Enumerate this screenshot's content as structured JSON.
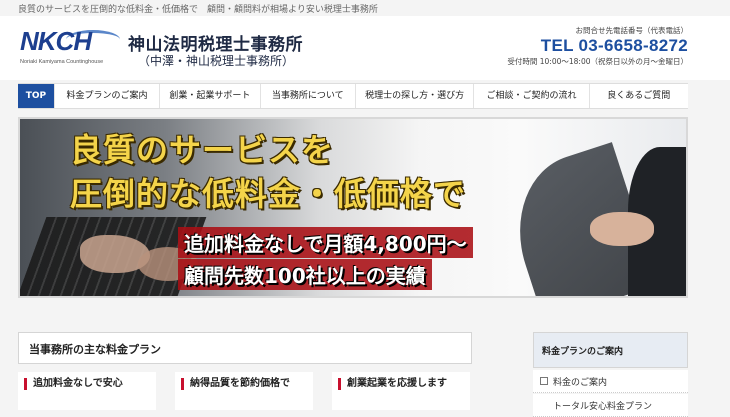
{
  "topbar": {
    "tagline": "良質のサービスを圧倒的な低料金・低価格で　顧問・顧問料が相場より安い税理士事務所"
  },
  "header": {
    "logo_text": "NKCH",
    "logo_sub": "Noriaki Kamiyama Countinghouse",
    "firm_name": "神山法明税理士事務所",
    "firm_sub": "（中澤・神山税理士事務所）",
    "contact_label": "お問合せ先電話番号（代表電話）",
    "tel": "TEL 03-6658-8272",
    "hours": "受付時間 10:00～18:00（祝祭日以外の月～金曜日）"
  },
  "nav": {
    "items": [
      {
        "label": "TOP",
        "active": true
      },
      {
        "label": "料金プランのご案内"
      },
      {
        "label": "創業・起業サポート"
      },
      {
        "label": "当事務所について"
      },
      {
        "label": "税理士の探し方・選び方"
      },
      {
        "label": "ご相談・ご契約の流れ"
      },
      {
        "label": "良くあるご質問"
      }
    ]
  },
  "hero": {
    "headline_1": "良質のサービスを",
    "headline_2": "圧倒的な低料金・低価格で",
    "sub_1": "追加料金なしで月額4,800円～",
    "sub_2": "顧問先数100社以上の実績"
  },
  "main": {
    "section_title": "当事務所の主な料金プラン",
    "cards": [
      {
        "title": "追加料金なしで安心"
      },
      {
        "title": "納得品質を節約価格で"
      },
      {
        "title": "創業起業を応援します"
      }
    ]
  },
  "sidebar": {
    "title": "料金プランのご案内",
    "items": [
      {
        "label": "料金のご案内"
      },
      {
        "label": "トータル安心料金プラン"
      }
    ]
  },
  "colors": {
    "brand_blue": "#1d4fa0",
    "headline_yellow": "#f4d44a",
    "accent_red": "#c8102e"
  }
}
